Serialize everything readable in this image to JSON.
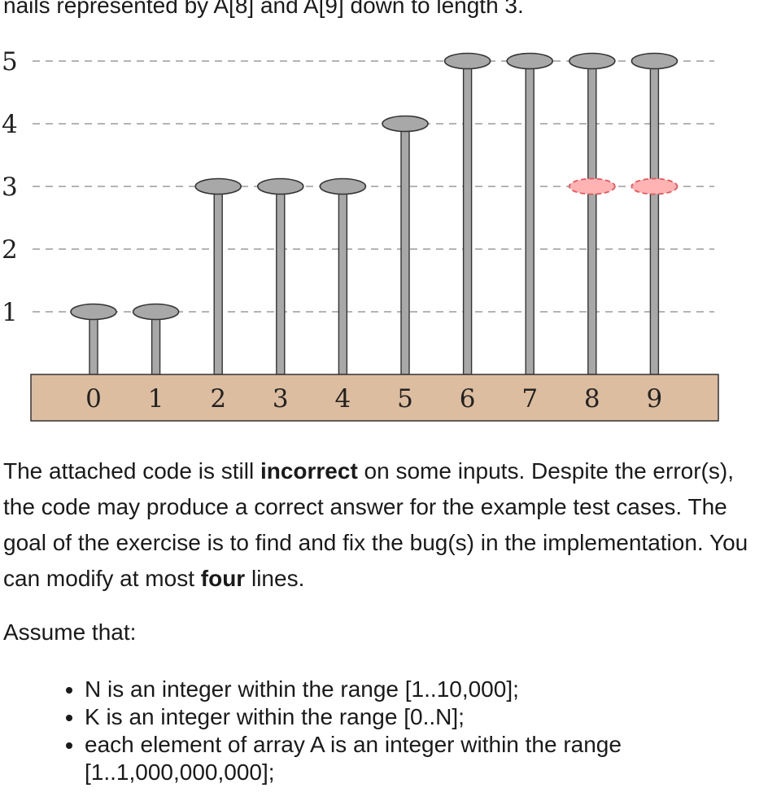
{
  "intro_fragment": "nails represented by A[8] and A[9] down to length 3.",
  "chart_data": {
    "type": "bar",
    "categories": [
      "0",
      "1",
      "2",
      "3",
      "4",
      "5",
      "6",
      "7",
      "8",
      "9"
    ],
    "values": [
      1,
      1,
      3,
      3,
      3,
      4,
      5,
      5,
      5,
      5
    ],
    "reduced": [
      {
        "index": 8,
        "value": 3
      },
      {
        "index": 9,
        "value": 3
      }
    ],
    "y_ticks": [
      "1",
      "2",
      "3",
      "4",
      "5"
    ],
    "ylim": [
      0,
      5
    ],
    "grid": "dashed horizontal",
    "colors": {
      "nail": "#a8a8a8",
      "board": "#ddbd9f",
      "reduced": "#ffb3b3",
      "reduced_edge": "#e8555a"
    }
  },
  "paragraph": {
    "part1": "The attached code is still ",
    "bold1": "incorrect",
    "part2": " on some inputs. Despite the error(s), the code may produce a correct answer for the example test cases. The goal of the exercise is to find and fix the bug(s) in the implementation. You can modify at most ",
    "bold2": "four",
    "part3": " lines."
  },
  "assume_label": "Assume that:",
  "bullets": [
    "N is an integer within the range [1..10,000];",
    "K is an integer within the range [0..N];",
    "each element of array A is an integer within the range [1..1,000,000,000];"
  ]
}
